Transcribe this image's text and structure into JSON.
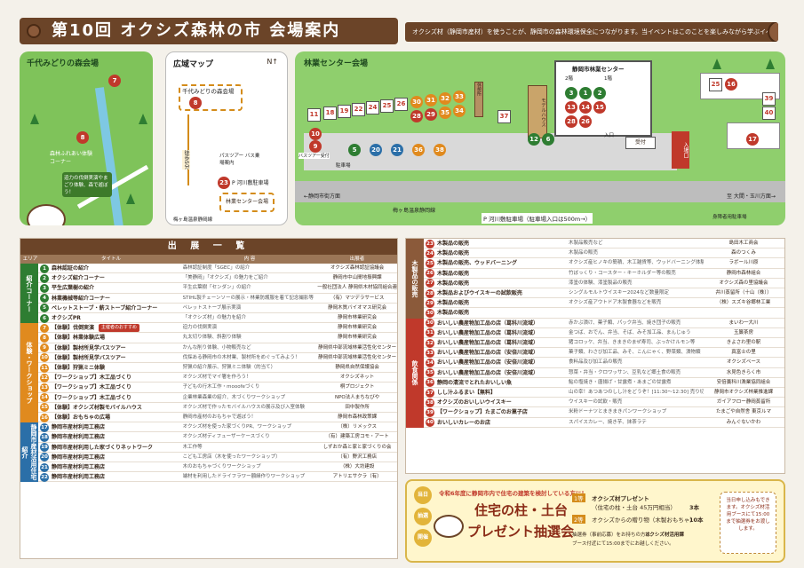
{
  "header": {
    "title": "第10回 オクシズ森林の市 会場案内",
    "note": "オクシズ材（静岡市産材）を使うことが、静岡市の森林環境保全につながります。当イベントはこのことを楽しみながら学ぶイベントです。"
  },
  "map1": {
    "title": "千代みどりの森会場",
    "label_exp": "森林ふれあい体験コーナー",
    "label_caption": "迫力の伐倒実演やまごり体験、森で遊ぼう！",
    "pins": [
      "7",
      "8"
    ]
  },
  "map2": {
    "title": "広域マップ",
    "venue1": "千代みどりの森会場",
    "venue2": "林業センター会場",
    "walk": "徒歩5分",
    "bus": "パスツアー バス乗場案内",
    "route_label": "P 河川敷駐車場",
    "route2": "梅ヶ島温泉静岡線",
    "pin23": "23",
    "pin8": "8"
  },
  "map3": {
    "title": "林業センター会場",
    "center": "静岡市林業センター",
    "floor1": "1階",
    "floor2": "2階",
    "reception": "受付",
    "entrance": "入口",
    "entrance_car": "入場口",
    "model": "モデルハウス",
    "rest": "休憩所",
    "parking_bus": "バスツアー受付",
    "parking": "駐車場",
    "road1": "←静岡市街方面",
    "road2": "梅ヶ島温泉静岡線",
    "road3": "至 大間・玉川方面→",
    "parking_lot": "P 河川敷駐車場（駐車場入口は500m→）",
    "disabled": "身障者用駐車場",
    "pins": [
      "11",
      "10",
      "9",
      "18",
      "19",
      "22",
      "24",
      "25",
      "26",
      "30",
      "31",
      "32",
      "33",
      "34",
      "35",
      "29",
      "28",
      "27",
      "37",
      "5",
      "20",
      "21",
      "36",
      "38",
      "4",
      "3",
      "1",
      "2",
      "13",
      "14",
      "15",
      "16",
      "17",
      "39",
      "40",
      "12",
      "6",
      "23"
    ]
  },
  "table1": {
    "title": "出 展 一 覧",
    "col_area": "エリア",
    "col_title": "タイトル",
    "col_desc": "内 容",
    "col_org": "出展者",
    "sections": [
      {
        "label": "紹介コーナー",
        "color": "#2e7d32"
      },
      {
        "label": "体験・ワークショップ",
        "color": "#e08a1e"
      },
      {
        "label": "静岡市産材活用住宅紹介",
        "color": "#2b6fa8"
      }
    ],
    "rows": [
      {
        "n": "1",
        "t": "森林認証の紹介",
        "d": "森林認証制度「SGEC」の紹介",
        "o": "オクシズ森林認証協議会",
        "c": "#2e7d32"
      },
      {
        "n": "2",
        "t": "オクシズ紹介コーナー",
        "d": "「美静岡」「オクシズ」の魅力をご紹介",
        "o": "静岡市中山間地振興課",
        "c": "#2e7d32"
      },
      {
        "n": "3",
        "t": "平生広葉樹の紹介",
        "d": "平生広葉樹「センダン」の紹介",
        "o": "一般社団法人 静岡県木材協同組合連合会",
        "c": "#2e7d32"
      },
      {
        "n": "4",
        "t": "林業機械等紹介コーナー",
        "d": "STIHL製チェーンソーの展示・林業防護服を着て記念撮影等",
        "o": "（有）マツデラサービス",
        "c": "#2e7d32"
      },
      {
        "n": "5",
        "t": "ペレットストーブ・薪ストーブ紹介コーナー",
        "d": "ペレットストーブ展示実演",
        "o": "静岡木質バイオマス研究会",
        "c": "#2e7d32"
      },
      {
        "n": "6",
        "t": "オクシズPR",
        "d": "「オクシズ材」の魅力を紹介",
        "o": "静岡市林業研究会",
        "c": "#2e7d32"
      },
      {
        "n": "7",
        "t": "【体験】伐倒実演",
        "d": "迫力の伐倒実演",
        "o": "静岡市林業研究会",
        "c": "#e08a1e",
        "tag": "主催者のおすすめ"
      },
      {
        "n": "8",
        "t": "【体験】林業体験広場",
        "d": "丸太切り体験、斜割り体験",
        "o": "静岡市林業研究会",
        "c": "#e08a1e"
      },
      {
        "n": "9",
        "t": "【体験】製材所見学バスツアー",
        "d": "かんな削り体験、小物販売など",
        "o": "静岡県中部流域林業活性化センター",
        "c": "#e08a1e"
      },
      {
        "n": "10",
        "t": "【体験】製材所見学バスツアー",
        "d": "伐採ある静岡市の木材業、製材所をめぐってみよう！",
        "o": "静岡県中部流域林業活性化センター",
        "c": "#e08a1e"
      },
      {
        "n": "11",
        "t": "【体験】狩猟ミニ体験",
        "d": "狩猟の紹介展示、狩猟ミニ体験（的当て）",
        "o": "静岡県自然保護協会",
        "c": "#e08a1e"
      },
      {
        "n": "12",
        "t": "【ワークショップ】木工品づくり",
        "d": "オクシズ材でマイ箸を作ろう！",
        "o": "オクシズネット",
        "c": "#e08a1e"
      },
      {
        "n": "13",
        "t": "【ワークショップ】木工品づくり",
        "d": "子どもの行木工作・mooofeづくり",
        "o": "桐プロジェクト",
        "c": "#e08a1e"
      },
      {
        "n": "14",
        "t": "【ワークショップ】木工品づくり",
        "d": "企業林業森業の紹介、木づくりワークショップ",
        "o": "NPO法人まちなびや",
        "c": "#e08a1e"
      },
      {
        "n": "15",
        "t": "【体験】オクシズ材製モバイルハウス",
        "d": "オクシズ材で作ったモバイルハウスの展示及び入室体験",
        "o": "田中製作所",
        "c": "#e08a1e"
      },
      {
        "n": "16",
        "t": "【体験】おもちゃの広場",
        "d": "静岡市産材のおもちゃで遊ぼう！",
        "o": "静岡市森林政策課",
        "c": "#e08a1e"
      },
      {
        "n": "17",
        "t": "静岡市産材利用工務店",
        "d": "オクシズ材を使った家づくりPR、ワークショップ",
        "o": "（株）リメックス",
        "c": "#2b6fa8"
      },
      {
        "n": "18",
        "t": "静岡市産材利用工務店",
        "d": "オクシズ材ディフューザーケースづくり",
        "o": "（有）建築工房コモ・アート",
        "c": "#2b6fa8"
      },
      {
        "n": "19",
        "t": "静岡市産材利用した家づくりネットワーク",
        "d": "木工作等",
        "o": "しずおか森と家と家づくりの会",
        "c": "#2b6fa8"
      },
      {
        "n": "20",
        "t": "静岡市産材利用工務店",
        "d": "こども工房店（木を使ったワークショップ）",
        "o": "（有）野沢工務店",
        "c": "#2b6fa8"
      },
      {
        "n": "21",
        "t": "静岡市産材利用工務店",
        "d": "木のおもちゃづくりワークショップ",
        "o": "（株）大坊建設",
        "c": "#2b6fa8"
      },
      {
        "n": "22",
        "t": "静岡市産材利用工務店",
        "d": "端材を利用したドライフラワー額縁作りワークショップ",
        "o": "アトリエサクラ（有）",
        "c": "#2b6fa8"
      }
    ]
  },
  "table2": {
    "sections": [
      {
        "label": "木製品の販売",
        "color": "#8b5a3a"
      },
      {
        "label": "飲食関係",
        "color": "#c0392b"
      }
    ],
    "rows": [
      {
        "n": "23",
        "t": "木製品の販売",
        "d": "木製品販売など",
        "o": "島田木工商会",
        "c": "#c0392b"
      },
      {
        "n": "24",
        "t": "木製品の販売",
        "d": "木製品の販売",
        "o": "森のつくみ",
        "c": "#c0392b"
      },
      {
        "n": "25",
        "t": "木製品の販売、ウッドバーニング",
        "d": "オクシズ産ヒノキの簡積、木工雑貨等、ウッドバーニング体験",
        "o": "ラボール川原",
        "c": "#c0392b"
      },
      {
        "n": "26",
        "t": "木製品の販売",
        "d": "竹ぼっくり・コースター・キーホルダー等の販売",
        "o": "静岡市森林組合",
        "c": "#c0392b"
      },
      {
        "n": "27",
        "t": "木製品の販売",
        "d": "漆塗の体験、漆塗製品の販売",
        "o": "オクシズ森の里協議会",
        "c": "#c0392b"
      },
      {
        "n": "28",
        "t": "木製品およびウイスキーの試飲販売",
        "d": "シングルモルトウイスキー2024など数量限定",
        "o": "井川蒸留所（十山（株））",
        "c": "#c0392b"
      },
      {
        "n": "29",
        "t": "木製品の販売",
        "d": "オクシズ産アウトドア木製食器などを販売",
        "o": "（株）スズキ谷郷林工業",
        "c": "#c0392b"
      },
      {
        "n": "30",
        "t": "木製品の販売",
        "d": "",
        "o": "",
        "c": "#c0392b"
      },
      {
        "n": "30",
        "t": "おいしい農産物加工品の店（葛科川流域）",
        "d": "赤かぶ漬け、菓子類、パック弁当、焼き団子の販売",
        "o": "まいわ一大川",
        "c": "#c0392b"
      },
      {
        "n": "31",
        "t": "おいしい農産物加工品の店（葛科川流域）",
        "d": "金つば、おでん、弁当、そば、みそ加工品、まんじゅう",
        "o": "玉簾茶房",
        "c": "#c0392b"
      },
      {
        "n": "32",
        "t": "おいしい農産物加工品の店（葛科川流域）",
        "d": "猪コロッケ、弁当、きまきのまぜ寿司、ぶっかけルモン等",
        "o": "きよさわ里の駅",
        "c": "#c0392b"
      },
      {
        "n": "33",
        "t": "おいしい農産物加工品の店（安倍川流域）",
        "d": "菓子類、わさび加工品、みそ、こんにゃく、野菜類、漬物類",
        "o": "真富士の里",
        "c": "#c0392b"
      },
      {
        "n": "34",
        "t": "おいしい農産物加工品の店（安倍川流域）",
        "d": "食料品及び加工品の販売",
        "o": "オクシズベース",
        "c": "#c0392b"
      },
      {
        "n": "35",
        "t": "おいしい農産物加工品の店（安倍川流域）",
        "d": "惣菜・弁当・クロワッサン、豆乳など郷土食の販売",
        "o": "水見色きらく市",
        "c": "#c0392b"
      },
      {
        "n": "36",
        "t": "静岡の清流でとれたおいしい魚",
        "d": "鮎の塩焼き・唐揚げ・甘露煮・あまごの甘露煮",
        "o": "安倍藁科川漁業協同組合",
        "c": "#c0392b"
      },
      {
        "n": "37",
        "t": "しし汁ふるまい【無料】",
        "d": "山の幸！あつあつのしし汁をどうぞ！[11:30～12:30] 売り切れ次第終了",
        "o": "静岡市オクシズ林業推進課",
        "c": "#c0392b"
      },
      {
        "n": "38",
        "t": "オクシズのおいしいウイスキー",
        "d": "ウイスキーの試飲・販売",
        "o": "ガイアフロー静岡蒸留所",
        "c": "#c0392b"
      },
      {
        "n": "39",
        "t": "【ワークショップ】たまごのお菓子店",
        "d": "米粉ドーナツとまきまきパンワークショップ",
        "o": "たまごや自然舎 東京ルマ",
        "c": "#c0392b"
      },
      {
        "n": "40",
        "t": "おいしいカレーのお店",
        "d": "スパイスカレー、焼き芋、抹茶ラテ",
        "o": "みんぐないかわ",
        "c": "#c0392b"
      }
    ]
  },
  "lottery": {
    "badges": [
      "当日",
      "抽選",
      "開催"
    ],
    "lead": "令和6年度に静岡市内で住宅の建築を検討している方に！",
    "title1": "住宅の柱・土台",
    "title2": "プレゼント抽選会",
    "p1_tag": "1等",
    "p1": "オクシズ材プレゼント",
    "p1_sub": "（住宅の柱・土台 45万円相当）",
    "p1_count": "3本",
    "p2_tag": "2等",
    "p2": "オクシズからの贈り物（木製おもちゃ）",
    "p2_count": "10本",
    "note1": "抽選券（事前応募）をお持ちの方は、",
    "note2": "オクシズ材活用課",
    "note3": "ブース付近にて15:00までにお越しください。",
    "info": "当日申し込みもできます。オクシズ材活用ブースにて15:00まで抽選券をお渡しします。"
  }
}
